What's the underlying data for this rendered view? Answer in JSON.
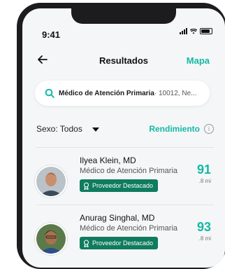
{
  "status_bar": {
    "time": "9:41"
  },
  "nav": {
    "title": "Resultados",
    "map_label": "Mapa"
  },
  "search": {
    "query": "Médico de Atención Primaria",
    "location": " · 10012, Ne..."
  },
  "filters": {
    "sex_label": "Sexo: Todos",
    "sort_label": "Rendimiento",
    "info_glyph": "i"
  },
  "results": [
    {
      "name": "Ilyea Klein, MD",
      "specialty": "Médico de Atención Primaria",
      "badge": "Proveedor Destacado",
      "score": "91",
      "distance": ".8 mi"
    },
    {
      "name": "Anurag Singhal, MD",
      "specialty": "Médico de Atención Primaria",
      "badge": "Proveedor Destacado",
      "score": "93",
      "distance": ".8 mi"
    }
  ],
  "colors": {
    "accent": "#14b8a6",
    "badge_bg": "#0f7b5f"
  }
}
